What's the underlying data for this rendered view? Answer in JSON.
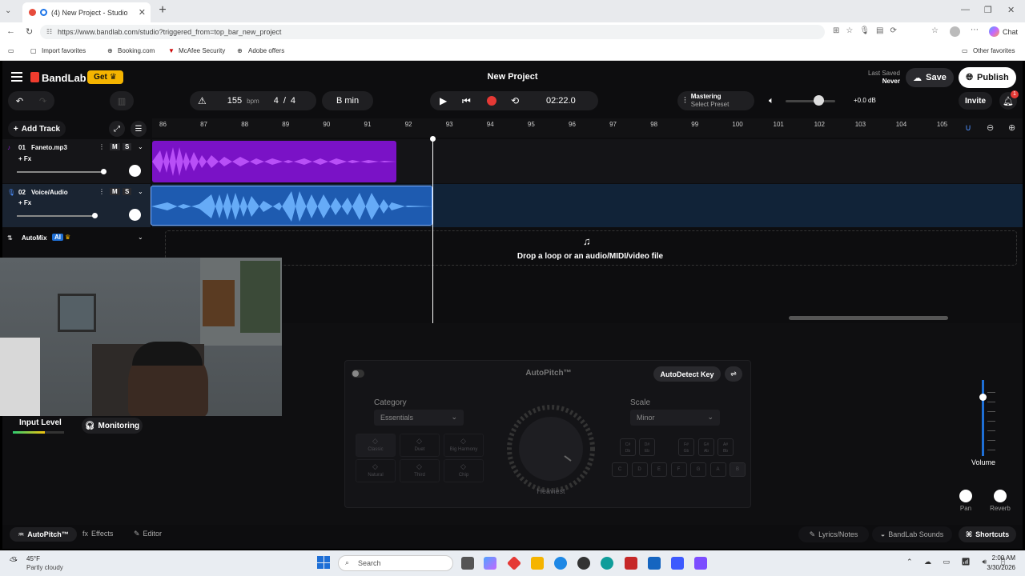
{
  "browser": {
    "tab_title": "(4) New Project - Studio",
    "url": "https://www.bandlab.com/studio?triggered_from=top_bar_new_project",
    "chat_label": "Chat",
    "bookmarks": [
      "Import favorites",
      "Booking.com",
      "McAfee Security",
      "Adobe offers"
    ],
    "other_favorites": "Other favorites"
  },
  "app": {
    "logo": "BandLab",
    "get_label": "Get",
    "project_title": "New Project",
    "last_saved_label": "Last Saved",
    "last_saved_value": "Never",
    "save_label": "Save",
    "publish_label": "Publish",
    "bpm_value": "155",
    "bpm_unit": "bpm",
    "time_sig_num": "4",
    "time_sig_sep": "/",
    "time_sig_den": "4",
    "key_label": "B min",
    "time_display": "02:22.0",
    "mastering_label": "Mastering",
    "mastering_preset": "Select Preset",
    "volume_db": "+0.0 dB",
    "invite_label": "Invite",
    "notif_count": "1",
    "add_track_label": "Add Track",
    "ruler_marks": [
      "86",
      "87",
      "88",
      "89",
      "90",
      "91",
      "92",
      "93",
      "94",
      "95",
      "96",
      "97",
      "98",
      "99",
      "100",
      "101",
      "102",
      "103",
      "104",
      "105"
    ],
    "tracks": [
      {
        "number": "01",
        "name": "Faneto.mp3",
        "fx": "+ Fx",
        "mute": "M",
        "solo": "S"
      },
      {
        "number": "02",
        "name": "Voice/Audio",
        "fx": "+ Fx",
        "mute": "M",
        "solo": "S"
      }
    ],
    "automix_label": "AutoMix",
    "ai_badge": "AI",
    "drop_text": "Drop a loop or an audio/MIDI/video file",
    "input_level_label": "Input Level",
    "monitoring_label": "Monitoring",
    "autopitch": {
      "title": "AutoPitch™",
      "autodetect_label": "AutoDetect Key",
      "category_label": "Category",
      "category_value": "Essentials",
      "scale_label": "Scale",
      "scale_value": "Minor",
      "knob_label": "Heaviest",
      "presets": [
        "Classic",
        "Duet",
        "Big Harmony",
        "Natural",
        "Third",
        "Chip"
      ],
      "sharp_keys": [
        "C#\nDb",
        "D#\nEb",
        "F#\nGb",
        "G#\nAb",
        "A#\nBb"
      ],
      "natural_keys": [
        "C",
        "D",
        "E",
        "F",
        "G",
        "A",
        "B"
      ]
    },
    "volume_label": "Volume",
    "pan_label": "Pan",
    "reverb_label": "Reverb",
    "bottom_tabs": [
      "AutoPitch™",
      "Effects",
      "Editor"
    ],
    "bottom_right": [
      "Lyrics/Notes",
      "BandLab Sounds",
      "Shortcuts"
    ]
  },
  "taskbar": {
    "weather_temp": "45°F",
    "weather_desc": "Partly cloudy",
    "search_placeholder": "Search",
    "time": "2:00 AM",
    "date": "3/30/2026"
  },
  "colors": {
    "track1": "#8a1fd6",
    "track2": "#1e6fd6",
    "accent_red": "#e53935",
    "bandlab_red": "#f03c2e",
    "get_yellow": "#f5b400"
  }
}
